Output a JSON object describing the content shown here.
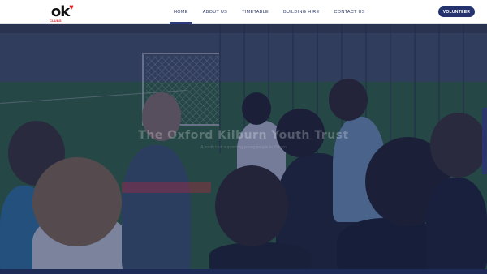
{
  "header": {
    "logo_text": "ok",
    "logo_word": "CLUBS",
    "nav": [
      {
        "label": "HOME",
        "active": true
      },
      {
        "label": "ABOUT US",
        "active": false
      },
      {
        "label": "TIMETABLE",
        "active": false
      },
      {
        "label": "BUILDING HIRE",
        "active": false
      },
      {
        "label": "CONTACT US",
        "active": false
      }
    ],
    "cta_label": "VOLUNTEER"
  },
  "hero": {
    "title": "The Oxford Kilburn Youth Trust",
    "subtitle": "A youth club supporting young people in Kilburn",
    "button_label": ""
  },
  "colors": {
    "primary": "#24336e",
    "nav_text": "#2a3566",
    "brand_red": "#e3232b",
    "overlay": "#1e2a5a"
  }
}
